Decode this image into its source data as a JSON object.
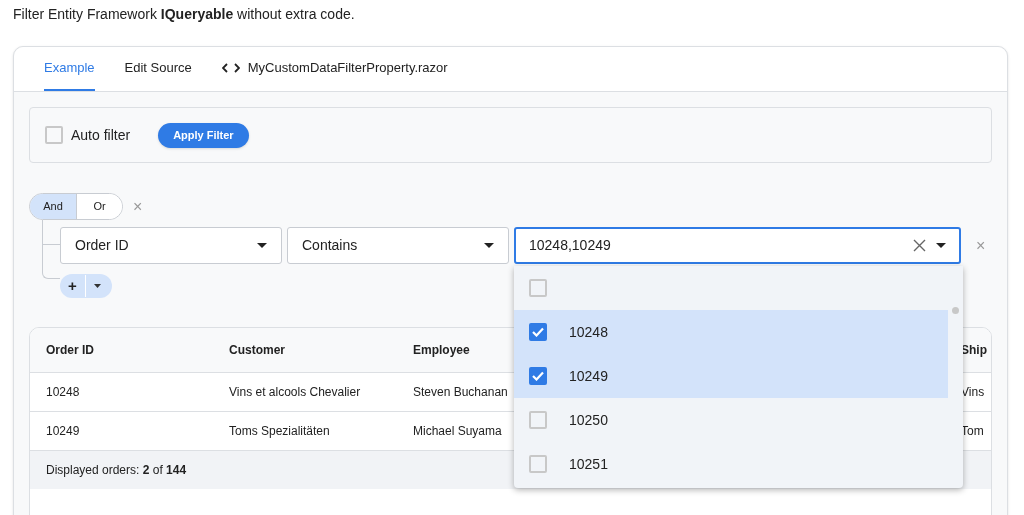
{
  "intro": "Filter Entity Framework **IQueryable** without extra code.",
  "tabs": [
    {
      "label": "Example",
      "selected": true,
      "kind": "text"
    },
    {
      "label": "Edit Source",
      "selected": false,
      "kind": "text"
    },
    {
      "label": "MyCustomDataFilterProperty.razor",
      "selected": false,
      "kind": "code"
    }
  ],
  "toolbar": {
    "auto_filter": {
      "label": "Auto filter",
      "checked": false
    },
    "apply_button": "Apply Filter"
  },
  "filter": {
    "operators": [
      {
        "label": "And",
        "selected": true
      },
      {
        "label": "Or",
        "selected": false
      }
    ],
    "remove_group": "×",
    "rule": {
      "property": "Order ID",
      "operator": "Contains",
      "value": "10248,10249",
      "remove": "×"
    },
    "add_button": "+"
  },
  "dropdown": {
    "options": [
      {
        "checked": false
      },
      {
        "label": "10248",
        "checked": true
      },
      {
        "label": "10249",
        "checked": true
      },
      {
        "label": "10250",
        "checked": false
      },
      {
        "label": "10251",
        "checked": false
      }
    ]
  },
  "table": {
    "columns": [
      "Order ID",
      "Customer",
      "Employee",
      "Ship"
    ],
    "rows": [
      [
        "10248",
        "Vins et alcools Chevalier",
        "Steven Buchanan",
        "Vins"
      ],
      [
        "10249",
        "Toms Spezialitäten",
        "Michael Suyama",
        "Tom"
      ]
    ],
    "footer": "Displayed orders: **2** of **144**"
  }
}
